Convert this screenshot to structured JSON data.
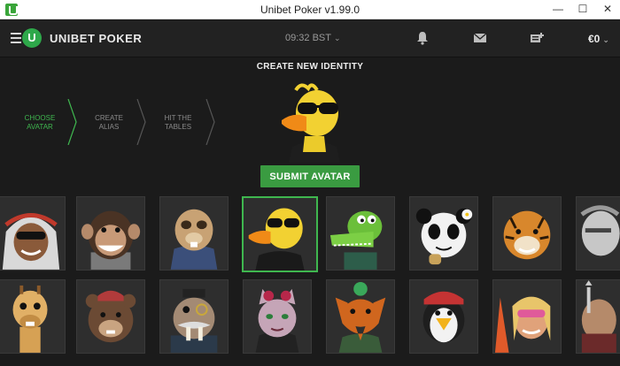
{
  "window": {
    "title": "Unibet Poker v1.99.0",
    "minimize": "—",
    "maximize": "☐",
    "close": "✕"
  },
  "header": {
    "brand": "UNIBET POKER",
    "brand_mark": "U",
    "time": "09:32 BST",
    "balance": "€0",
    "chevron": "⌄",
    "icons": [
      "menu-icon",
      "bell-icon",
      "mail-icon",
      "cashier-icon"
    ]
  },
  "page": {
    "title": "CREATE NEW IDENTITY",
    "submit_label": "SUBMIT AVATAR"
  },
  "steps": [
    {
      "line1": "CHOOSE",
      "line2": "AVATAR",
      "active": true
    },
    {
      "line1": "CREATE",
      "line2": "ALIAS",
      "active": false
    },
    {
      "line1": "HIT THE",
      "line2": "TABLES",
      "active": false
    }
  ],
  "avatars": {
    "selected_index": 3,
    "row1": [
      "sheikh",
      "chimpanzee",
      "meerkat",
      "duck",
      "crocodile",
      "panda",
      "tiger",
      "knight"
    ],
    "row2": [
      "giraffe",
      "bear",
      "walrus",
      "cat",
      "fox",
      "penguin",
      "surfer",
      "warrior"
    ]
  },
  "colors": {
    "accent": "#3fb74f",
    "button": "#3a9b41",
    "header": "#222222",
    "background": "#1b1b1b"
  }
}
